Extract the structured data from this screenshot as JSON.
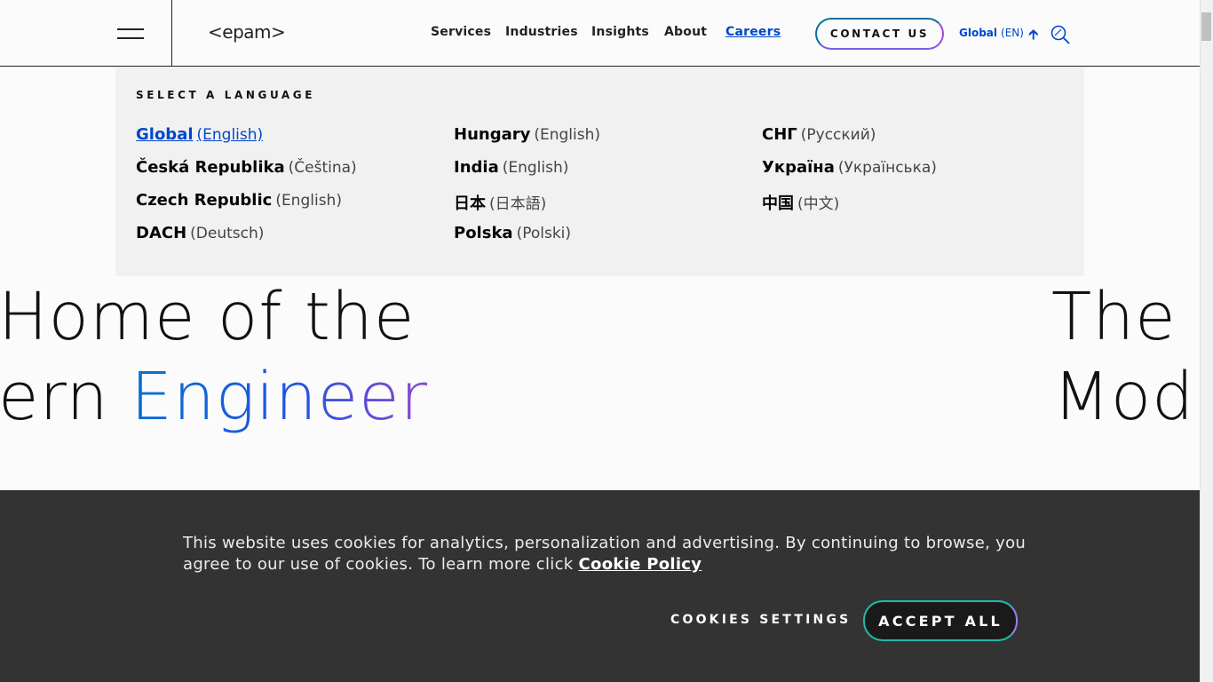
{
  "header": {
    "logo": "<epam>",
    "nav": [
      "Services",
      "Industries",
      "Insights",
      "About",
      "Careers"
    ],
    "active_nav": "Careers",
    "contact_label": "CONTACT US",
    "region": "Global",
    "region_code": "(EN)"
  },
  "language_menu": {
    "title": "SELECT A LANGUAGE",
    "columns": [
      [
        {
          "country": "Global",
          "language": "(English)",
          "active": true
        },
        {
          "country": "Česká Republika",
          "language": "(Čeština)"
        },
        {
          "country": "Czech Republic",
          "language": "(English)"
        },
        {
          "country": "DACH",
          "language": "(Deutsch)"
        }
      ],
      [
        {
          "country": "Hungary",
          "language": "(English)"
        },
        {
          "country": "India",
          "language": "(English)"
        },
        {
          "country": "日本",
          "language": "(日本語)"
        },
        {
          "country": "Polska",
          "language": "(Polski)"
        }
      ],
      [
        {
          "country": "СНГ",
          "language": "(Русский)"
        },
        {
          "country": "Україна",
          "language": "(Українська)"
        },
        {
          "country": "中国",
          "language": "(中文)"
        }
      ]
    ]
  },
  "hero": {
    "left_line1": "Home of the",
    "left_line2_plain": "ern ",
    "left_line2_highlight": "Engineer",
    "right_line1": "The",
    "right_line2": "Mod"
  },
  "cookie_banner": {
    "text": "This website uses cookies for analytics, personalization and advertising. By continuing to browse, you agree to our use of cookies. To learn more click ",
    "link": "Cookie Policy",
    "settings_label": "COOKIES SETTINGS",
    "accept_label": "ACCEPT ALL"
  },
  "colors": {
    "accent": "#0047cc",
    "banner_bg": "#333333",
    "panel_bg": "#f1f1f1"
  }
}
